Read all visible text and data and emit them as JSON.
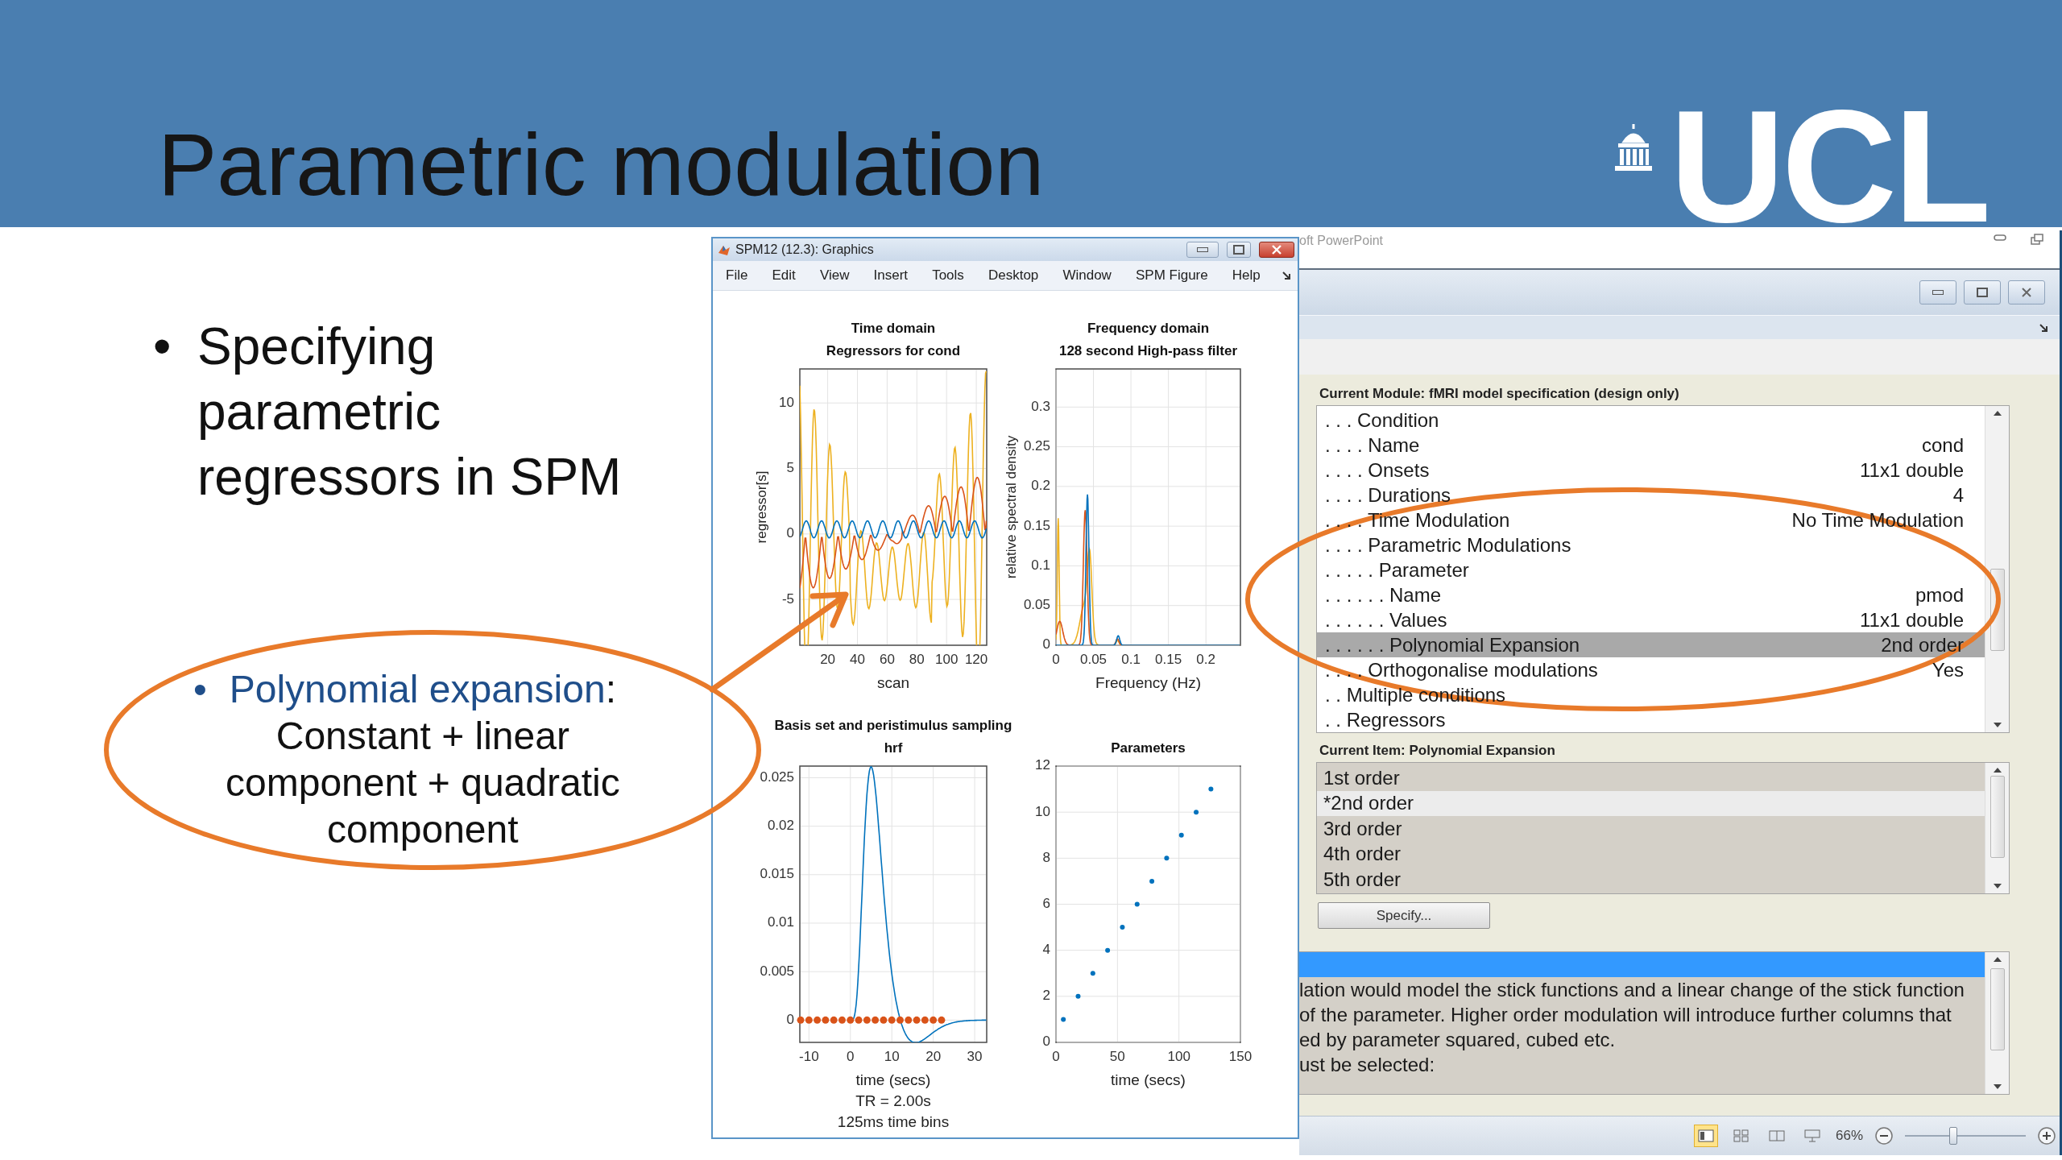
{
  "slide": {
    "title": "Parametric modulation",
    "logo_text": "UCL",
    "bullet": {
      "marker": "•",
      "lines": [
        "Specifying",
        "parametric",
        "regressors in SPM"
      ]
    },
    "callout": {
      "marker": "•",
      "term": "Polynomial expansion",
      "term_suffix": ":",
      "lines": [
        "Constant + linear",
        "component + quadratic",
        "component"
      ]
    }
  },
  "graphics_window": {
    "title": "SPM12 (12.3): Graphics",
    "menu": [
      "File",
      "Edit",
      "View",
      "Insert",
      "Tools",
      "Desktop",
      "Window",
      "SPM Figure",
      "Help"
    ],
    "panels": [
      {
        "kind": "regressors",
        "title_lines": [
          "Time domain",
          "Regressors for cond"
        ],
        "ylabel": "regressor[s]",
        "xlabel": "scan",
        "xticks": [
          "20",
          "40",
          "60",
          "80",
          "100",
          "120"
        ],
        "yticks": [
          "10",
          "5",
          "0",
          "-5"
        ]
      },
      {
        "kind": "spectrum",
        "title_lines": [
          "Frequency domain",
          "128 second High-pass filter"
        ],
        "ylabel": "relative spectral density",
        "xlabel": "Frequency (Hz)",
        "xticks": [
          "0",
          "0.05",
          "0.1",
          "0.15",
          "0.2"
        ],
        "yticks": [
          "0.3",
          "0.25",
          "0.2",
          "0.15",
          "0.1",
          "0.05",
          "0"
        ]
      },
      {
        "kind": "hrf",
        "title_lines": [
          "Basis set and peristimulus sampling",
          "hrf"
        ],
        "xlabel_lines": [
          "time (secs)",
          "TR = 2.00s",
          "125ms time bins"
        ],
        "xticks": [
          "-10",
          "0",
          "10",
          "20",
          "30"
        ],
        "yticks": [
          "0.025",
          "0.02",
          "0.015",
          "0.01",
          "0.005",
          "0"
        ]
      },
      {
        "kind": "scatter",
        "chart_data": {
          "type": "scatter",
          "title": "Parameters",
          "xlabel": "time (secs)",
          "x": [
            6,
            18,
            30,
            42,
            54,
            66,
            78,
            90,
            102,
            114,
            126
          ],
          "values": [
            1,
            2,
            3,
            4,
            5,
            6,
            7,
            8,
            9,
            10,
            11
          ],
          "xlim": [
            0,
            150
          ],
          "ylim": [
            0,
            12
          ],
          "xticks": [
            0,
            50,
            100,
            150
          ],
          "yticks": [
            0,
            2,
            4,
            6,
            8,
            10,
            12
          ],
          "grid": true
        }
      }
    ]
  },
  "batch_window": {
    "app_title": "oft PowerPoint",
    "module_label": "Current Module: fMRI model specification (design only)",
    "tree_rows": [
      {
        "label": ". . . Condition",
        "selected": false
      },
      {
        "label": ". . . . Name",
        "value": "cond",
        "selected": false
      },
      {
        "label": ". . . . Onsets",
        "value": "11x1 double",
        "selected": false
      },
      {
        "label": ". . . . Durations",
        "value": "4",
        "selected": false
      },
      {
        "label": ". . . . Time Modulation",
        "value": "No Time Modulation",
        "selected": false
      },
      {
        "label": ". . . . Parametric Modulations",
        "selected": false
      },
      {
        "label": ". . . . . Parameter",
        "selected": false
      },
      {
        "label": ". . . . . . Name",
        "value": "pmod",
        "selected": false
      },
      {
        "label": ". . . . . . Values",
        "value": "11x1 double",
        "selected": false
      },
      {
        "label": ". . . . . . Polynomial Expansion",
        "value": "2nd order",
        "selected": true
      },
      {
        "label": ". . . . Orthogonalise modulations",
        "value": "Yes",
        "selected": false
      },
      {
        "label": ". . Multiple conditions",
        "selected": false
      },
      {
        "label": ". . Regressors",
        "selected": false
      }
    ],
    "item_label": "Current Item: Polynomial Expansion",
    "options": [
      {
        "label": "1st order",
        "selected": false
      },
      {
        "label": "*2nd order",
        "selected": true
      },
      {
        "label": "3rd order",
        "selected": false
      },
      {
        "label": "4th order",
        "selected": false
      },
      {
        "label": "5th order",
        "selected": false
      }
    ],
    "specify_button": "Specify...",
    "help_lines": [
      "lation would model the stick functions and a linear change of the stick function",
      "of  the  parameter. Higher order modulation will introduce further columns that",
      "ed by parameter squared, cubed etc.",
      "ust be selected:"
    ],
    "zoom_text": "66%",
    "zoom": {
      "level": 0.4
    }
  }
}
